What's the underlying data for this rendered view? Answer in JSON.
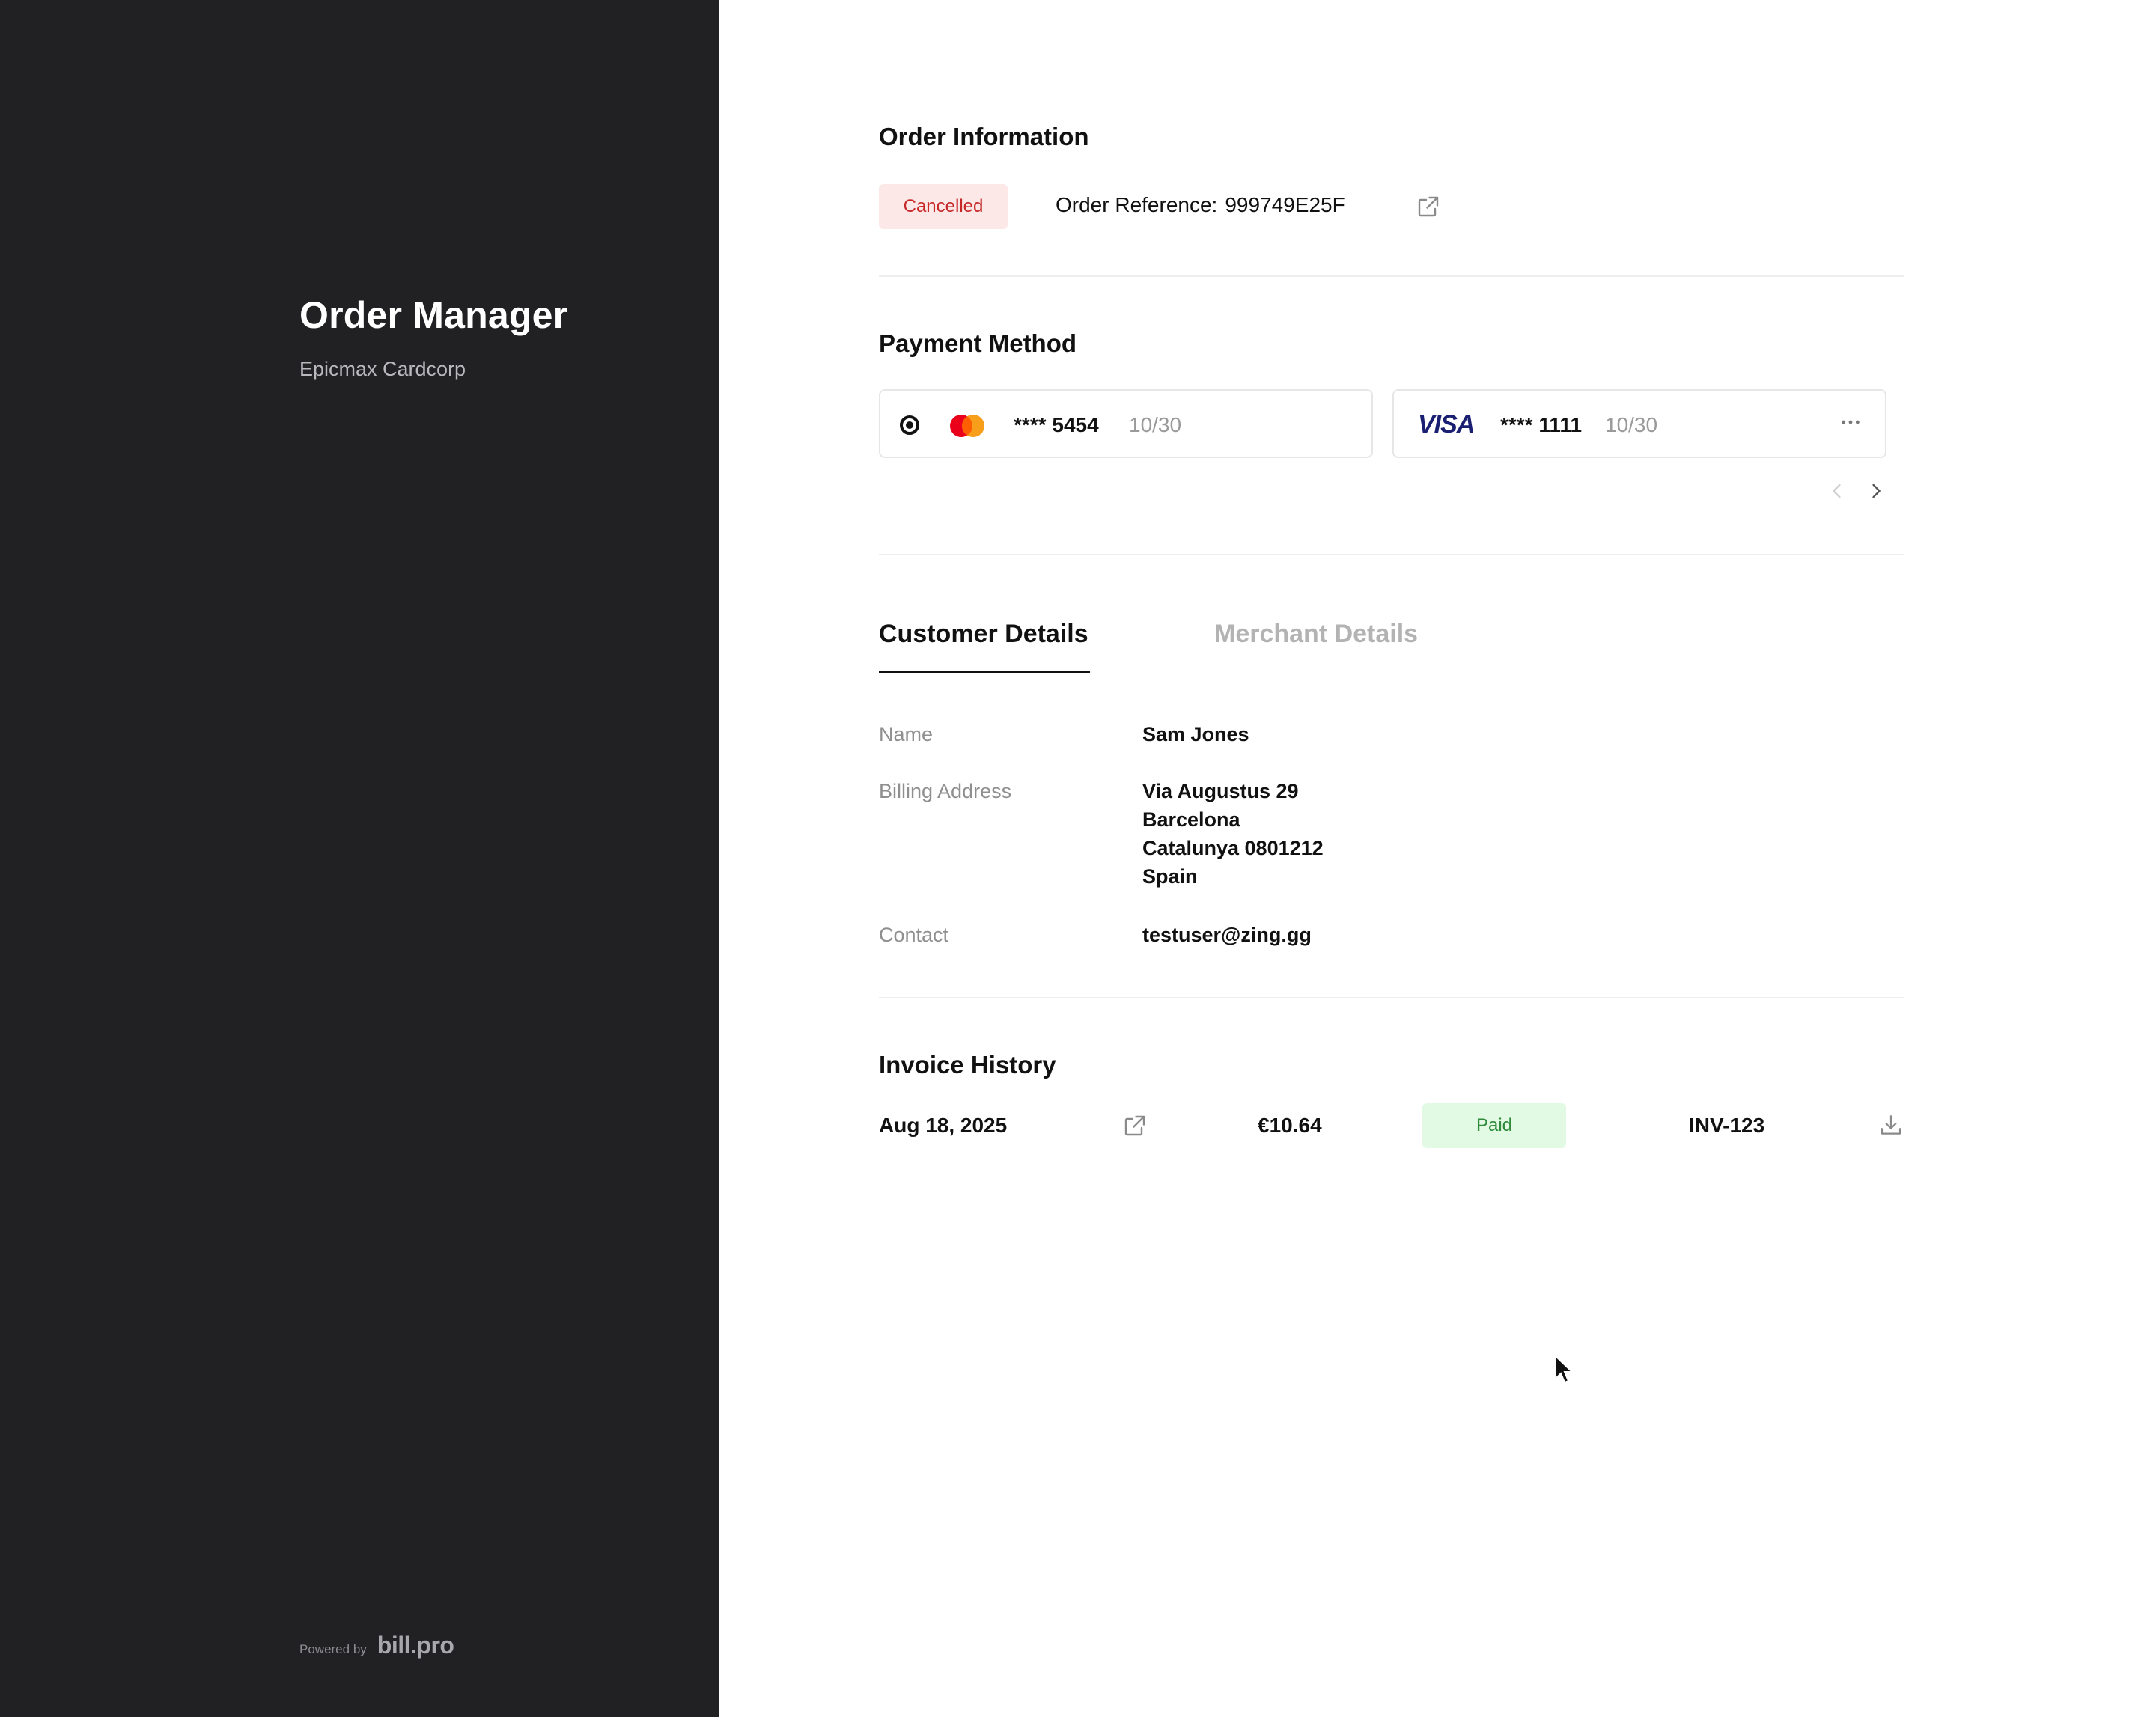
{
  "brand": {
    "title": "Order Manager",
    "subtitle": "Epicmax Cardcorp",
    "powered_label": "Powered by",
    "powered_logo": "bill.pro"
  },
  "order_info": {
    "title": "Order Information",
    "status": "Cancelled",
    "reference_label": "Order Reference:",
    "reference_value": "999749E25F",
    "open_icon": "external-link-icon"
  },
  "payment": {
    "title": "Payment Method",
    "cards": [
      {
        "brand": "Mastercard",
        "number": "**** 5454",
        "expiry": "10/30",
        "selected": true
      },
      {
        "brand": "VISA",
        "number": "**** 1111",
        "expiry": "10/30",
        "selected": false
      }
    ],
    "more_icon": "more-horizontal-icon",
    "prev_icon": "chevron-left-icon",
    "next_icon": "chevron-right-icon"
  },
  "tabs": {
    "customer": "Customer Details",
    "merchant": "Merchant Details",
    "active": "customer"
  },
  "customer": {
    "name_label": "Name",
    "name": "Sam Jones",
    "address_label": "Billing Address",
    "address_line1": "Via Augustus 29",
    "address_line2": "Barcelona",
    "address_line3": "Catalunya 0801212",
    "address_line4": "Spain",
    "contact_label": "Contact",
    "contact": "testuser@zing.gg"
  },
  "invoice_history": {
    "title": "Invoice History",
    "rows": [
      {
        "date": "Aug 18, 2025",
        "amount": "€10.64",
        "status": "Paid",
        "number": "INV-123"
      }
    ],
    "download_icon": "download-icon"
  },
  "colors": {
    "sidebar_bg": "#212123",
    "cancelled_bg": "#fde8e8",
    "cancelled_text": "#c62828",
    "paid_bg": "#e2f9e4",
    "paid_text": "#2e8b3a",
    "visa_blue": "#1a1f71",
    "mastercard_red": "#eb001b",
    "mastercard_orange": "#f79e1b"
  }
}
